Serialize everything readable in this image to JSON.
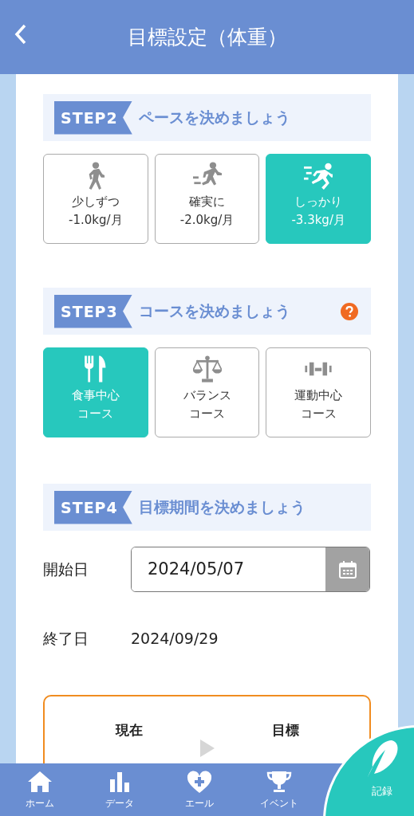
{
  "header": {
    "title": "目標設定（体重）"
  },
  "steps": [
    {
      "badge": "STEP2",
      "title": "ペースを決めましょう",
      "help": false,
      "options": [
        {
          "kind": "walk",
          "lines": [
            "少しずつ",
            "-1.0kg/月"
          ],
          "selected": false
        },
        {
          "kind": "jog",
          "lines": [
            "確実に",
            "-2.0kg/月"
          ],
          "selected": false
        },
        {
          "kind": "sprint",
          "lines": [
            "しっかり",
            "-3.3kg/月"
          ],
          "selected": true
        }
      ]
    },
    {
      "badge": "STEP3",
      "title": "コースを決めましょう",
      "help": true,
      "options": [
        {
          "kind": "meal",
          "lines": [
            "食事中心",
            "コース"
          ],
          "selected": true
        },
        {
          "kind": "balance",
          "lines": [
            "バランス",
            "コース"
          ],
          "selected": false
        },
        {
          "kind": "exercise",
          "lines": [
            "運動中心",
            "コース"
          ],
          "selected": false
        }
      ]
    },
    {
      "badge": "STEP4",
      "title": "目標期間を決めましょう",
      "help": false
    }
  ],
  "period": {
    "start_label": "開始日",
    "start_value": "2024/05/07",
    "end_label": "終了日",
    "end_value": "2024/09/29"
  },
  "summary": {
    "current_label": "現在",
    "target_label": "目標"
  },
  "nav": [
    {
      "kind": "home",
      "label": "ホーム"
    },
    {
      "kind": "data",
      "label": "データ"
    },
    {
      "kind": "cheer",
      "label": "エール"
    },
    {
      "kind": "event",
      "label": "イベント"
    }
  ],
  "record": {
    "label": "記録"
  }
}
